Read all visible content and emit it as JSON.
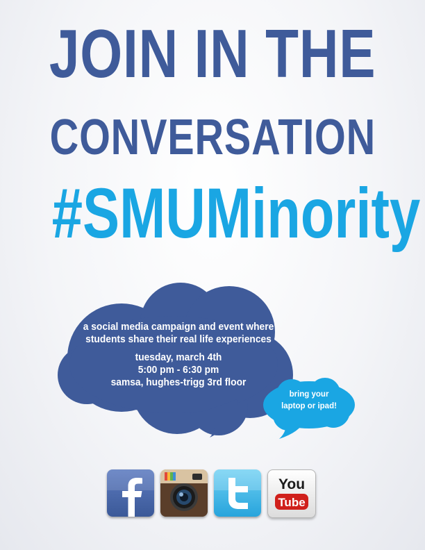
{
  "headline": {
    "line1": "JOIN IN THE",
    "line2": "CONVERSATION",
    "hashtag": "#SMUMinority"
  },
  "event": {
    "description_line1": "a social media campaign and event where",
    "description_line2": "students share their real life experiences",
    "date": "tuesday, march 4th",
    "time": "5:00 pm - 6:30 pm",
    "location": "samsa, hughes-trigg 3rd floor"
  },
  "reminder": {
    "line1": "bring your",
    "line2": "laptop or ipad!"
  },
  "social_icons": [
    {
      "name": "facebook-icon"
    },
    {
      "name": "instagram-icon"
    },
    {
      "name": "twitter-icon"
    },
    {
      "name": "youtube-icon",
      "label_top": "You",
      "label_bottom": "Tube"
    }
  ],
  "colors": {
    "headline_blue": "#3f5b9a",
    "hashtag_blue": "#1aa6e3",
    "bubble_main": "#3f5b9a",
    "bubble_small": "#1aa6e3"
  }
}
